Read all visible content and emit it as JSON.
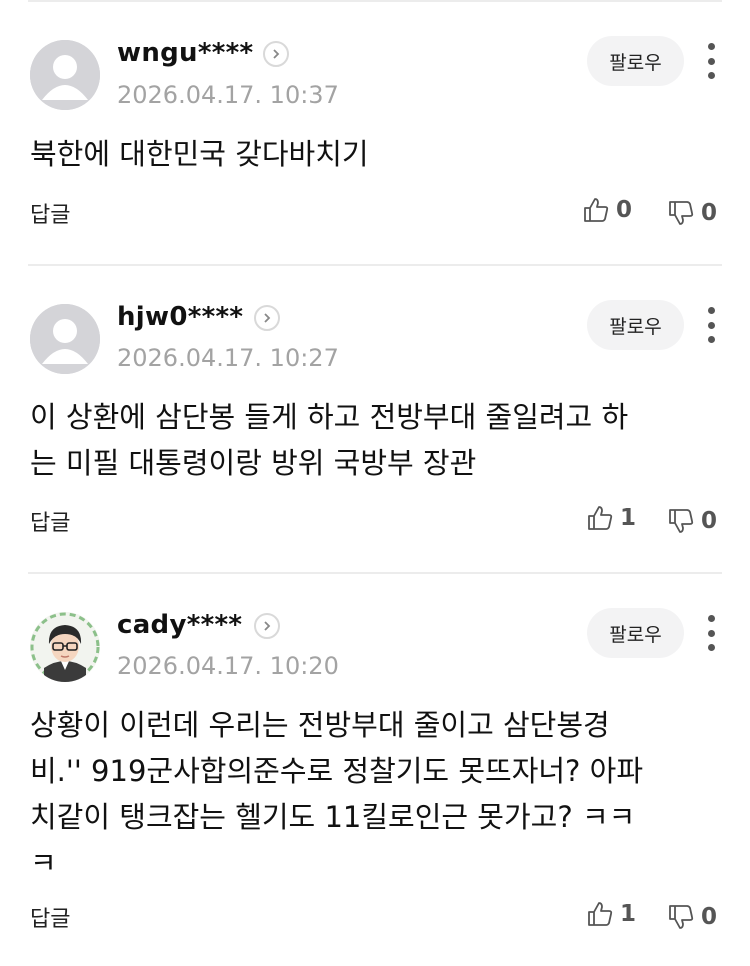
{
  "comments": [
    {
      "username": "wngu****",
      "timestamp": "2026.04.17. 10:37",
      "follow_label": "팔로우",
      "lines": [
        "북한에 대한민국 갖다바치기"
      ],
      "reply_label": "답글",
      "likes": "0",
      "dislikes": "0",
      "avatar": "default"
    },
    {
      "username": "hjw0****",
      "timestamp": "2026.04.17. 10:27",
      "follow_label": "팔로우",
      "lines": [
        "이 상환에 삼단봉 들게 하고 전방부대 줄일려고 하",
        "는 미필 대통령이랑 방위 국방부 장관"
      ],
      "reply_label": "답글",
      "likes": "1",
      "dislikes": "0",
      "avatar": "default"
    },
    {
      "username": "cady****",
      "timestamp": "2026.04.17. 10:20",
      "follow_label": "팔로우",
      "lines": [
        "상황이 이런데 우리는 전방부대 줄이고 삼단봉경",
        "비.'' 919군사합의준수로 정찰기도 못뜨자너? 아파",
        "치같이 탱크잡는 헬기도 11킬로인근 못가고? ㅋㅋ",
        "ㅋ"
      ],
      "reply_label": "답글",
      "likes": "1",
      "dislikes": "0",
      "avatar": "custom"
    }
  ],
  "colors": {
    "timestamp": "#a3a3a3",
    "follow_bg": "#f3f3f4",
    "divider": "#ececec"
  },
  "icons": {
    "profile": "chevron-right-icon",
    "more": "more-vertical-icon",
    "like": "thumbs-up-icon",
    "dislike": "thumbs-down-icon"
  }
}
